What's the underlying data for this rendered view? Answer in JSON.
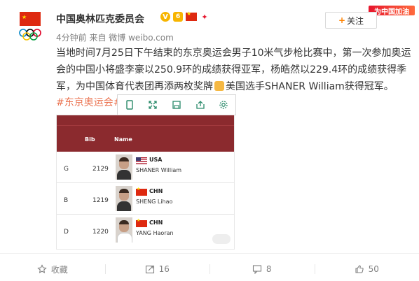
{
  "post": {
    "author": "中国奥林匹克委员会",
    "badges": {
      "verified": "V",
      "level": "6"
    },
    "follow_label": "关注",
    "promo_tag": "为中国加油",
    "meta": "4分钟前 来自 微博 weibo.com",
    "content": "当地时间7月25日下午结束的东京奥运会男子10米气步枪比赛中，第一次参加奥运会的中国小将盛李豪以250.9环的成绩获得亚军，杨皓然以229.4环的成绩获得季军，为中国体育代表团再添两枚奖牌",
    "content_tail": "美国选手SHANER William获得冠军。",
    "hashtag": "#东京奥运会#",
    "toolbar_icons": [
      "phone-icon",
      "expand-icon",
      "save-icon",
      "share-icon",
      "settings-icon"
    ]
  },
  "image_table": {
    "headers": [
      "Bib",
      "Name"
    ],
    "rows": [
      {
        "rank": "G",
        "bib": "2129",
        "country": "USA",
        "name": "SHANER William"
      },
      {
        "rank": "B",
        "bib": "1219",
        "country": "CHN",
        "name": "SHENG Lihao"
      },
      {
        "rank": "D",
        "bib": "1220",
        "country": "CHN",
        "name": "YANG Haoran"
      }
    ]
  },
  "actions": {
    "collect": "收藏",
    "repost": "16",
    "comment": "8",
    "like": "50"
  },
  "colors": {
    "accent": "#ff8200",
    "hashtag": "#eb7350",
    "header_bg": "#8b2a2e"
  }
}
